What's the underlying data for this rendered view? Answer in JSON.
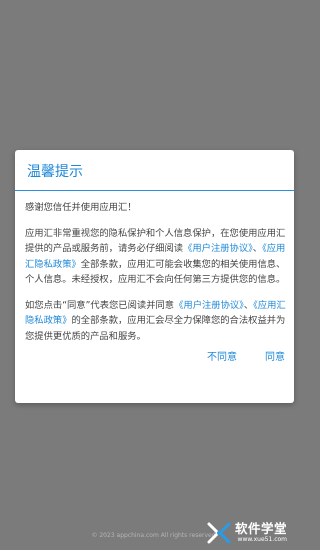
{
  "dialog": {
    "title": "温馨提示",
    "greeting": "感谢您信任并使用应用汇！",
    "para1": {
      "t1": "应用汇非常重视您的隐私保护和个人信息保护，在您使用应用汇提供的产品或服务前，请务必仔细阅读",
      "link1": "《用户注册协议》",
      "t2": "、",
      "link2": "《应用汇隐私政策》",
      "t3": "全部条款，应用汇可能会收集您的相关使用信息、个人信息。未经授权，应用汇不会向任何第三方提供您的信息。"
    },
    "para2": {
      "t1": "如您点击“同意”代表您已阅读并同意",
      "link1": "《用户注册协议》",
      "t2": "、",
      "link2": "《应用汇隐私政策》",
      "t3": "的全部条款，应用汇会尽全力保障您的合法权益并为您提供更优质的产品和服务。"
    },
    "disagree_label": "不同意",
    "agree_label": "同意"
  },
  "footer": {
    "copyright": "© 2023 appchina.com All rights reserved"
  },
  "watermark": {
    "title": "软件学堂",
    "url": "www.xue51.com"
  },
  "colors": {
    "overlay": "#7b7b7b",
    "accent": "#1e88d8",
    "body_text": "#444444"
  }
}
